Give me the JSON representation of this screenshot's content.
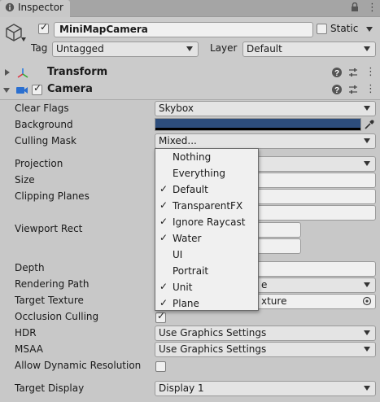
{
  "tab": {
    "label": "Inspector"
  },
  "object": {
    "name": "MiniMapCamera",
    "static_label": "Static",
    "tag_label": "Tag",
    "tag_value": "Untagged",
    "layer_label": "Layer",
    "layer_value": "Default"
  },
  "components": {
    "transform": "Transform",
    "camera": "Camera"
  },
  "camera": {
    "clear_flags_label": "Clear Flags",
    "clear_flags_value": "Skybox",
    "background_label": "Background",
    "background_color": "#2d4d7c",
    "culling_mask_label": "Culling Mask",
    "culling_mask_value": "Mixed...",
    "projection_label": "Projection",
    "size_label": "Size",
    "clipping_label": "Clipping Planes",
    "viewport_label": "Viewport Rect",
    "depth_label": "Depth",
    "rendering_path_label": "Rendering Path",
    "rendering_path_value": "e",
    "target_texture_label": "Target Texture",
    "target_texture_value": "xture",
    "occlusion_label": "Occlusion Culling",
    "hdr_label": "HDR",
    "hdr_value": "Use Graphics Settings",
    "msaa_label": "MSAA",
    "msaa_value": "Use Graphics Settings",
    "dynres_label": "Allow Dynamic Resolution",
    "target_display_label": "Target Display",
    "target_display_value": "Display 1"
  },
  "mask_menu": {
    "items": [
      {
        "label": "Nothing",
        "checked": false
      },
      {
        "label": "Everything",
        "checked": false
      },
      {
        "label": "Default",
        "checked": true
      },
      {
        "label": "TransparentFX",
        "checked": true
      },
      {
        "label": "Ignore Raycast",
        "checked": true
      },
      {
        "label": "Water",
        "checked": true
      },
      {
        "label": "UI",
        "checked": false
      },
      {
        "label": "Portrait",
        "checked": false
      },
      {
        "label": "Unit",
        "checked": true
      },
      {
        "label": "Plane",
        "checked": true
      }
    ],
    "check_glyph": "✓"
  }
}
